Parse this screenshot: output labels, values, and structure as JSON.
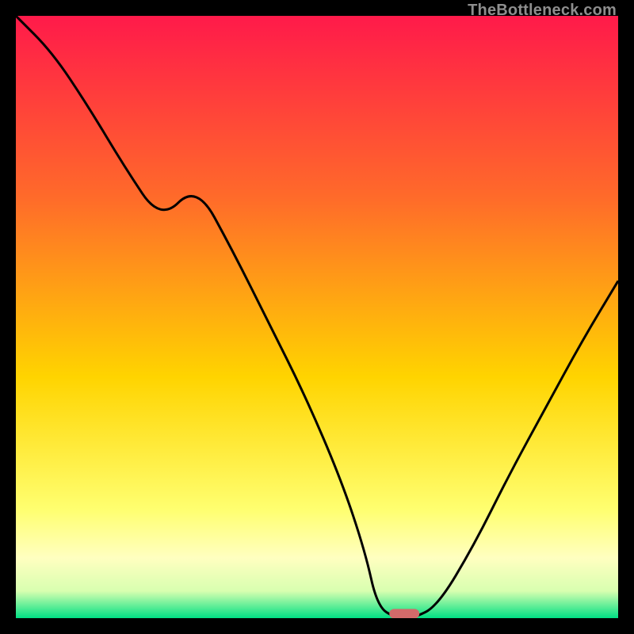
{
  "watermark": "TheBottleneck.com",
  "colors": {
    "background": "#000000",
    "gradient_top": "#ff1a4a",
    "gradient_mid_upper": "#ff6a2a",
    "gradient_mid": "#ffd400",
    "gradient_pale": "#ffffc0",
    "gradient_bottom": "#00e084",
    "curve": "#000000",
    "baseline_marker": "#d36a6a"
  },
  "chart_data": {
    "type": "line",
    "title": "",
    "xlabel": "",
    "ylabel": "",
    "ylim": [
      0,
      100
    ],
    "xlim": [
      0,
      100
    ],
    "x": [
      0,
      6,
      12,
      18,
      24,
      30,
      36,
      42,
      48,
      54,
      58,
      60,
      63,
      66,
      70,
      76,
      82,
      88,
      94,
      100
    ],
    "values": [
      100,
      94,
      85,
      75,
      66,
      72,
      61,
      49,
      37,
      23,
      11,
      2,
      0,
      0,
      2,
      12,
      24,
      35,
      46,
      56
    ],
    "baseline_marker": {
      "x_start": 62,
      "x_end": 67,
      "y": 0.6
    },
    "gradient_stops": [
      {
        "offset": 0.0,
        "color": "#ff1a4a"
      },
      {
        "offset": 0.3,
        "color": "#ff6a2a"
      },
      {
        "offset": 0.6,
        "color": "#ffd400"
      },
      {
        "offset": 0.82,
        "color": "#ffff70"
      },
      {
        "offset": 0.9,
        "color": "#ffffc0"
      },
      {
        "offset": 0.955,
        "color": "#d8ffb0"
      },
      {
        "offset": 1.0,
        "color": "#00e084"
      }
    ]
  }
}
